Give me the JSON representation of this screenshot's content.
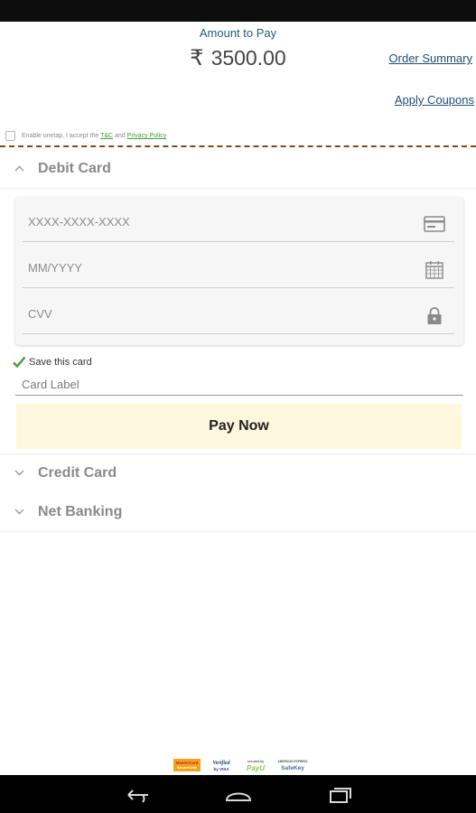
{
  "payment": {
    "amount_label": "Amount to Pay",
    "currency_symbol": "₹",
    "amount": "3500.00"
  },
  "links": {
    "order_summary": "Order Summary",
    "apply_coupons": "Apply Coupons"
  },
  "onetap": {
    "text_before": "Enable onetap, I accept the",
    "tnc": "T&C",
    "and": "and",
    "privacy": "Privacy Policy"
  },
  "sections": {
    "debit": "Debit Card",
    "credit": "Credit Card",
    "netbanking": "Net Banking"
  },
  "debit_form": {
    "card_number_placeholder": "XXXX-XXXX-XXXX",
    "expiry_placeholder": "MM/YYYY",
    "cvv_placeholder": "CVV",
    "save_card_label": "Save this card",
    "save_card_checked": true,
    "card_label_placeholder": "Card Label",
    "pay_button": "Pay Now"
  },
  "footer_logos": [
    "MasterCard SecureCode",
    "Verified by VISA",
    "PayU",
    "SafeKey"
  ],
  "colors": {
    "link": "#1c4d73",
    "accent_green": "#3a9f3a",
    "pay_button_bg": "#fdf7dd",
    "divider": "#8b4513"
  }
}
